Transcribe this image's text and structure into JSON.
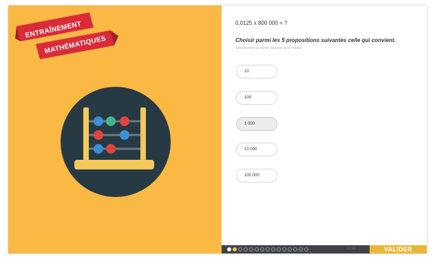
{
  "banner": {
    "line1": "ENTRAÎNEMENT",
    "line2": "MATHÉMATIQUES"
  },
  "question": {
    "text": "0,0125 x 800 000 = ?",
    "instruction": "Choisir parmi les 5 propositions suivantes celle qui convient.",
    "hint": "Sélectionnez la bonne réponse puis validez."
  },
  "options": [
    {
      "label": "10",
      "selected": false
    },
    {
      "label": "100",
      "selected": false
    },
    {
      "label": "1 000",
      "selected": true
    },
    {
      "label": "10 000",
      "selected": false
    },
    {
      "label": "100 000",
      "selected": false
    }
  ],
  "progress": {
    "current": 1,
    "total": 15,
    "counter_text": "1 / 15"
  },
  "footer": {
    "validate_label": "VALIDER"
  },
  "icons": {
    "illustration": "abacus-icon"
  },
  "colors": {
    "left_background": "#f9b944",
    "circle": "#273a43",
    "ribbon": "#d92b3a",
    "accent": "#eab839",
    "footer": "#3f4347"
  }
}
